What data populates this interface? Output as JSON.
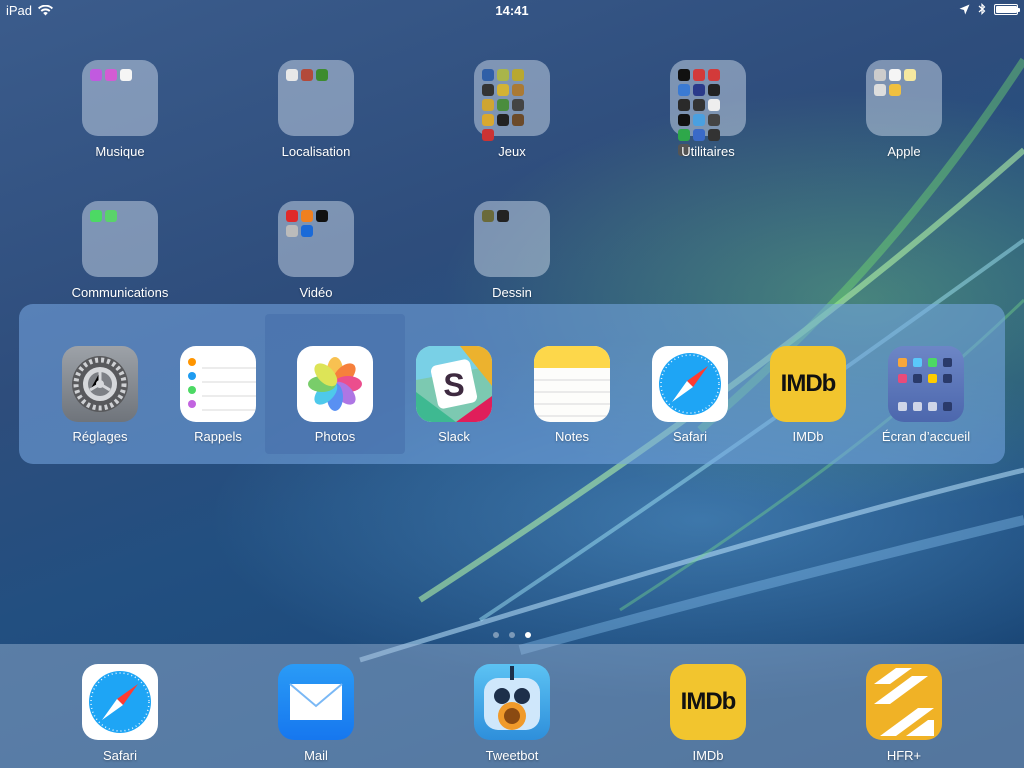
{
  "status_bar": {
    "device": "iPad",
    "time": "14:41",
    "battery_level": 0.95
  },
  "folders": [
    {
      "label": "Musique",
      "colors": [
        "#c15adf",
        "#d45bd3",
        "#f5f5f5"
      ]
    },
    {
      "label": "Localisation",
      "colors": [
        "#e8e8e8",
        "#b34a3a",
        "#3d8c2e"
      ]
    },
    {
      "label": "Jeux",
      "colors": [
        "#2f5fa7",
        "#a9b54a",
        "#b8a830",
        "#333333",
        "#d3b335",
        "#aa7a35",
        "#cfa532",
        "#4a8d3d",
        "#444444",
        "#d9a830",
        "#222222",
        "#6b4a2a",
        "#cc3333"
      ]
    },
    {
      "label": "Utilitaires",
      "colors": [
        "#111111",
        "#d33a3a",
        "#d33a3a",
        "#3a7ad3",
        "#2a3a8a",
        "#222222",
        "#2a2a2a",
        "#333333",
        "#eeeeee",
        "#111111",
        "#4aa0e0",
        "#444444",
        "#2ea84a",
        "#3a6ac8",
        "#333333",
        "#555555"
      ]
    },
    {
      "label": "Apple",
      "colors": [
        "#cccccc",
        "#f5f5f5",
        "#f5e8a0",
        "#dddddd",
        "#f0c040"
      ]
    },
    {
      "label": "Communications",
      "colors": [
        "#4cd964",
        "#5ad36a"
      ]
    },
    {
      "label": "Vidéo",
      "colors": [
        "#e02a2a",
        "#f08020",
        "#111111",
        "#bbbbbb",
        "#1a6ad8"
      ]
    },
    {
      "label": "Dessin",
      "colors": [
        "#6a6a3a",
        "#222222"
      ]
    }
  ],
  "switcher": {
    "apps": [
      {
        "label": "Réglages",
        "icon": "settings-icon",
        "selected": false
      },
      {
        "label": "Rappels",
        "icon": "reminders-icon",
        "selected": false
      },
      {
        "label": "Photos",
        "icon": "photos-icon",
        "selected": true
      },
      {
        "label": "Slack",
        "icon": "slack-icon",
        "selected": false
      },
      {
        "label": "Notes",
        "icon": "notes-icon",
        "selected": false
      },
      {
        "label": "Safari",
        "icon": "safari-icon",
        "selected": false
      },
      {
        "label": "IMDb",
        "icon": "imdb-icon",
        "selected": false,
        "logo_text": "IMDb"
      },
      {
        "label": "Écran d’accueil",
        "icon": "home-screen-icon",
        "selected": false
      }
    ]
  },
  "page_dots": {
    "count": 3,
    "active_index": 2
  },
  "dock": {
    "apps": [
      {
        "label": "Safari",
        "icon": "safari-icon"
      },
      {
        "label": "Mail",
        "icon": "mail-icon"
      },
      {
        "label": "Tweetbot",
        "icon": "tweetbot-icon"
      },
      {
        "label": "IMDb",
        "icon": "imdb-icon",
        "logo_text": "IMDb"
      },
      {
        "label": "HFR+",
        "icon": "hfr-icon"
      }
    ]
  }
}
